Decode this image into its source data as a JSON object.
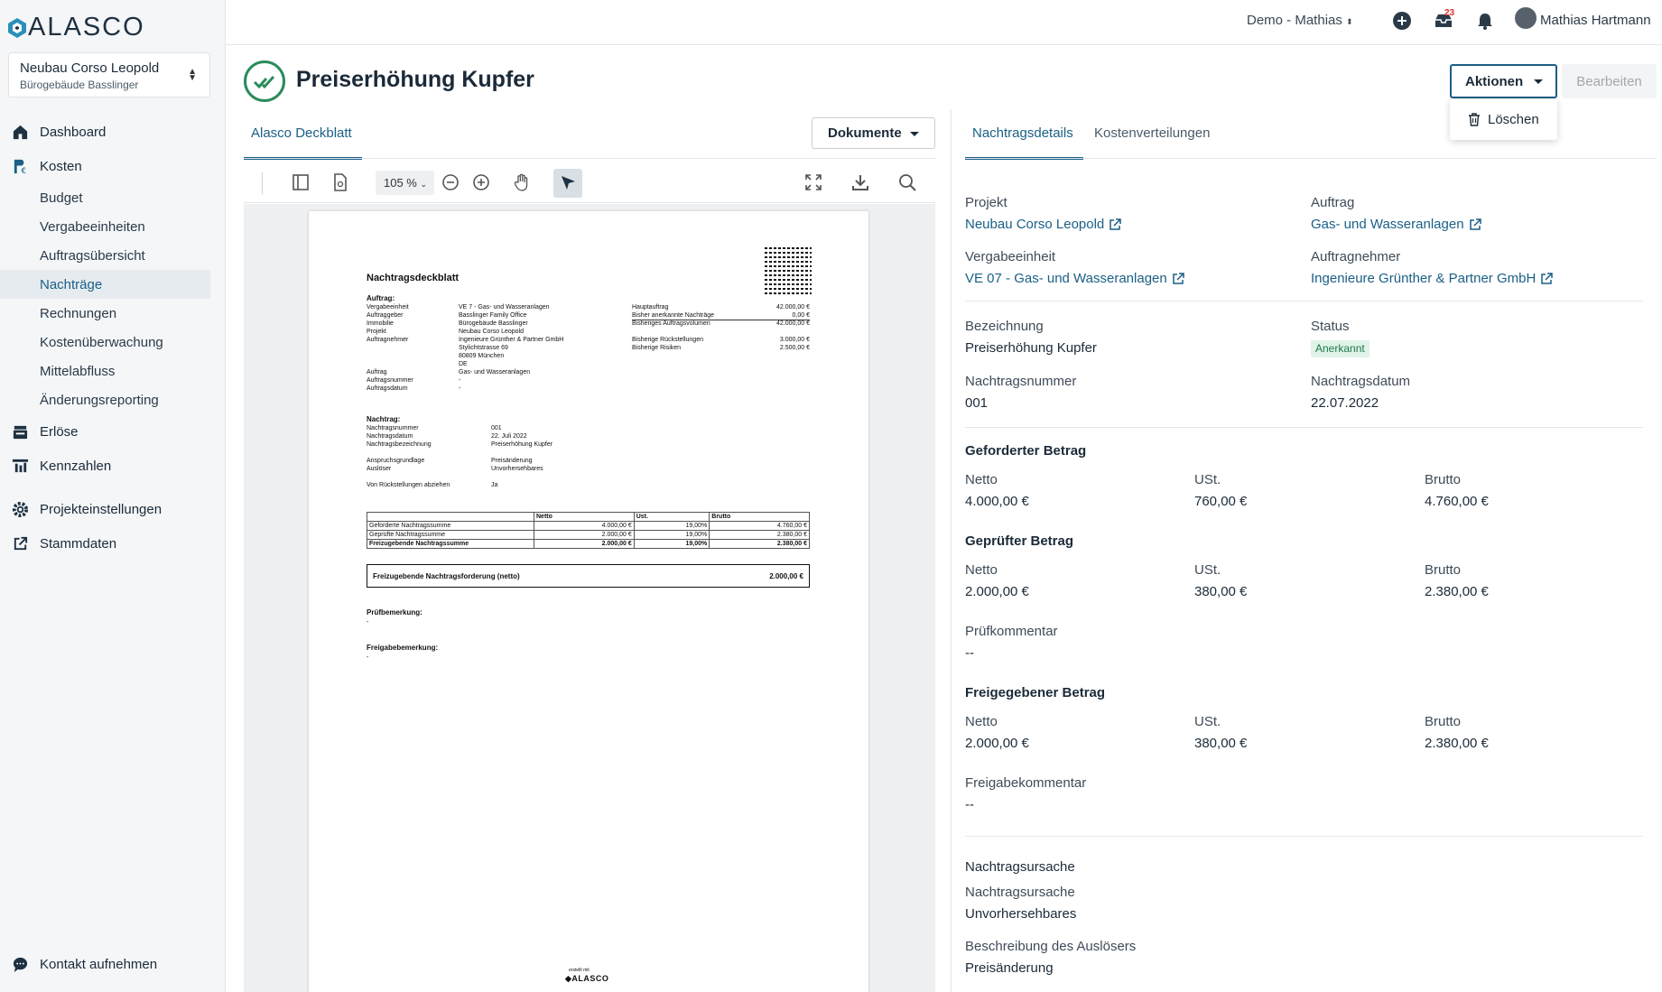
{
  "logo": {
    "text": "ALASCO"
  },
  "project_selector": {
    "name": "Neubau Corso Leopold",
    "sub": "Bürogebäude Basslinger"
  },
  "nav": {
    "dashboard": "Dashboard",
    "kosten": "Kosten",
    "kosten_sub": [
      "Budget",
      "Vergabeeinheiten",
      "Auftragsübersicht",
      "Nachträge",
      "Rechnungen",
      "Kostenüberwachung",
      "Mittelabfluss",
      "Änderungsreporting"
    ],
    "erloese": "Erlöse",
    "kennzahlen": "Kennzahlen",
    "projekteinstellungen": "Projekteinstellungen",
    "stammdaten": "Stammdaten",
    "contact": "Kontakt aufnehmen"
  },
  "topbar": {
    "demo": "Demo - Mathias",
    "inbox_badge": "23",
    "user": "Mathias Hartmann"
  },
  "header": {
    "title": "Preiserhöhung Kupfer",
    "aktionen": "Aktionen",
    "bearbeiten": "Bearbeiten",
    "dropdown_delete": "Löschen"
  },
  "left_panel": {
    "tab": "Alasco Deckblatt",
    "documents_button": "Dokumente",
    "zoom": "105 %"
  },
  "pdf": {
    "title": "Nachtragsdeckblatt",
    "auftrag_heading": "Auftrag:",
    "auftrag_labels": "Vergabeeinheit\nAuftraggeber\nImmobilie\nProjekt\nAuftragnehmer\n\n\n\nAuftrag\nAuftragsnummer\nAuftragsdatum",
    "auftrag_values": "VE 7 - Gas- und Wasseranlagen\nBasslinger Family Office\nBürogebäude Basslinger\nNeubau Corso Leopold\nIngenieure Grünther & Partner GmbH\nStylichtstrasse 69\n80809 München\nDE\nGas- und Wasseranlagen\n-\n-",
    "summary_labels": "Hauptauftrag\nBisher anerkannte Nachträge\nBisheriges Auftragsvolumen\n\nBisherige Rückstellungen\nBisherige Risiken",
    "summary_values": "42.000,00 €\n0,00 €\n42.000,00 €\n\n3.000,00 €\n2.500,00 €",
    "nachtrag_heading": "Nachtrag:",
    "nachtrag_labels": "Nachtragsnummer\nNachtragsdatum\nNachtragsbezeichnung\n\nAnspruchsgrundlage\nAuslöser\n\nVon Rückstellungen abziehen",
    "nachtrag_values": "001\n22. Juli 2022\nPreiserhöhung Kupfer\n\nPreisänderung\nUnvorhersehbares\n\nJa",
    "table_header": [
      "",
      "Netto",
      "Ust.",
      "Brutto"
    ],
    "table_rows": [
      [
        "Geforderte Nachtragssumme",
        "4.000,00 €",
        "19,00%",
        "4.760,00 €"
      ],
      [
        "Geprüfte Nachtragssumme",
        "2.000,00 €",
        "19,00%",
        "2.380,00 €"
      ],
      [
        "Freizugebende Nachtragssumme",
        "2.000,00 €",
        "19,00%",
        "2.380,00 €"
      ]
    ],
    "freigabe_label": "Freizugebende Nachtragsforderung (netto)",
    "freigabe_value": "2.000,00 €",
    "pruef_heading": "Prüfbemerkung:",
    "pruef_value": "-",
    "freigabe_heading": "Freigabebemerkung:",
    "freigabe_bem_value": "-",
    "footer_small": "erstellt mit",
    "footer_logo": "ALASCO"
  },
  "right_panel": {
    "tab_details": "Nachtragsdetails",
    "tab_kosten": "Kostenverteilungen",
    "projekt_label": "Projekt",
    "projekt_value": "Neubau Corso Leopold",
    "auftrag_label": "Auftrag",
    "auftrag_value": "Gas- und Wasseranlagen",
    "vergabe_label": "Vergabeeinheit",
    "vergabe_value": "VE 07 - Gas- und Wasseranlagen",
    "auftragnehmer_label": "Auftragnehmer",
    "auftragnehmer_value": "Ingenieure Grünther & Partner GmbH",
    "bezeichnung_label": "Bezeichnung",
    "bezeichnung_value": "Preiserhöhung Kupfer",
    "status_label": "Status",
    "status_value": "Anerkannt",
    "nummer_label": "Nachtragsnummer",
    "nummer_value": "001",
    "datum_label": "Nachtragsdatum",
    "datum_value": "22.07.2022",
    "gefordert": {
      "title": "Geforderter Betrag",
      "netto": "4.000,00 €",
      "ust": "760,00 €",
      "brutto": "4.760,00 €"
    },
    "geprueft": {
      "title": "Geprüfter Betrag",
      "netto": "2.000,00 €",
      "ust": "380,00 €",
      "brutto": "2.380,00 €"
    },
    "pruefkommentar_label": "Prüfkommentar",
    "pruefkommentar_value": "--",
    "freigegeben": {
      "title": "Freigegebener Betrag",
      "netto": "2.000,00 €",
      "ust": "380,00 €",
      "brutto": "2.380,00 €"
    },
    "freigabekommentar_label": "Freigabekommentar",
    "freigabekommentar_value": "--",
    "col_netto": "Netto",
    "col_ust": "USt.",
    "col_brutto": "Brutto",
    "ursache_section": "Nachtragsursache",
    "ursache_label": "Nachtragsursache",
    "ursache_value": "Unvorhersehbares",
    "ausloeser_label": "Beschreibung des Auslösers",
    "ausloeser_value": "Preisänderung"
  },
  "colors": {
    "primary": "#1a5f86",
    "success": "#2a8b5b",
    "badge": "#e02d2d"
  }
}
